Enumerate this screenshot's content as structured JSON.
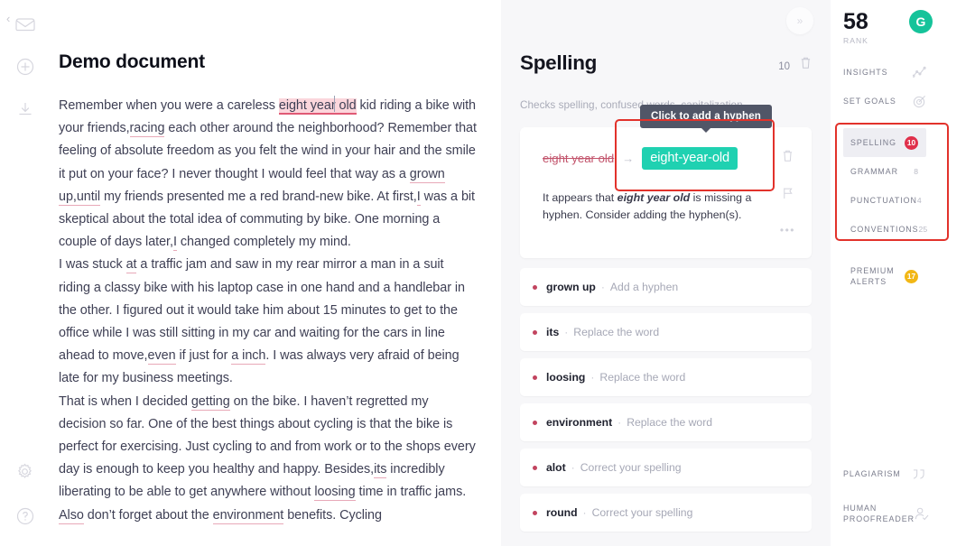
{
  "rail": {
    "back_icon": "chevron-left-icon",
    "items": [
      {
        "name": "mail-icon"
      },
      {
        "name": "add-icon"
      },
      {
        "name": "download-icon"
      }
    ],
    "bottom": [
      {
        "name": "settings-gear-icon"
      },
      {
        "name": "help-icon"
      }
    ]
  },
  "document": {
    "title": "Demo document",
    "paragraphs": [
      "Remember when you were a careless ",
      " kid riding a bike with your friends,",
      " each other around the neighborhood? Remember that feeling of absolute freedom as you felt the wind in your hair and the smile it put on your face? I never thought I would feel that way as a ",
      " my friends presented me a red brand-new bike. At first,",
      " was a bit skeptical about the total idea of commuting by bike. One morning a couple of days later,",
      " changed completely my mind."
    ],
    "highlight_text": "eight year old",
    "inline_marks": [
      "racing",
      "grown up,until",
      "I",
      "I",
      "at",
      "even",
      "a inch",
      "getting",
      "its",
      "loosing",
      "Also",
      "environment"
    ],
    "para2": "I was stuck at a traffic jam and saw in my rear mirror a man in a suit riding a classy bike with his laptop case in one hand and a handlebar in the other. I figured out it would take him about 15 minutes to get to the office while I was still sitting in my car and waiting for the cars in line ahead to move,even if just for a inch. I was always very afraid of being late for my business meetings.",
    "para3": "That is when I decided getting on the bike. I haven't regretted my decision so far. One of the best things about cycling is that the bike is perfect for exercising. Just cycling to and from work or to the shops every day is enough to keep you healthy and happy. Besides,its incredibly liberating to be able to get anywhere without loosing time in traffic jams. Also don't forget about the environment benefits. Cycling"
  },
  "assistant": {
    "collapse_icon": "double-chevron-right-icon",
    "title": "Spelling",
    "count": "10",
    "trash_icon": "trash-icon",
    "subtitle": "Checks spelling, confused words, capitalization",
    "card": {
      "original": "eight year old",
      "arrow": "→",
      "suggestion": "eight-year-old",
      "tooltip": "Click to add a hyphen",
      "description_before": "It appears that ",
      "description_emphasis": "eight year old",
      "description_after": " is missing a hyphen. Consider adding the hyphen(s).",
      "tools": [
        "trash-icon",
        "flag-icon",
        "more-options-icon"
      ]
    },
    "suggestions": [
      {
        "word": "grown up",
        "action": "Add a hyphen"
      },
      {
        "word": "its",
        "action": "Replace the word"
      },
      {
        "word": "loosing",
        "action": "Replace the word"
      },
      {
        "word": "environment",
        "action": "Replace the word"
      },
      {
        "word": "alot",
        "action": "Correct your spelling"
      },
      {
        "word": "round",
        "action": "Correct your spelling"
      }
    ]
  },
  "sidebar": {
    "score": "58",
    "score_label": "RANK",
    "avatar_letter": "G",
    "top_items": [
      {
        "label": "INSIGHTS",
        "icon": "line-chart-icon"
      },
      {
        "label": "SET GOALS",
        "icon": "target-icon"
      }
    ],
    "categories": [
      {
        "label": "SPELLING",
        "count": "10",
        "badge": "red",
        "active": true
      },
      {
        "label": "GRAMMAR",
        "count": "8",
        "badge": "grey",
        "active": false
      },
      {
        "label": "PUNCTUATION",
        "count": "4",
        "badge": "grey",
        "active": false
      },
      {
        "label": "CONVENTIONS",
        "count": "25",
        "badge": "grey",
        "active": false
      }
    ],
    "premium": {
      "label_line1": "PREMIUM",
      "label_line2": "ALERTS",
      "count": "17"
    },
    "bottom_items": [
      {
        "label_line1": "PLAGIARISM",
        "label_line2": "",
        "icon": "quote-icon"
      },
      {
        "label_line1": "HUMAN",
        "label_line2": "PROOFREADER",
        "icon": "person-check-icon"
      }
    ]
  },
  "colors": {
    "accent_teal": "#1fd1b1",
    "alert_red": "#e0304b",
    "annotation_red": "#e2322b",
    "premium_yellow": "#f2b715",
    "brand_green": "#15c39a"
  }
}
